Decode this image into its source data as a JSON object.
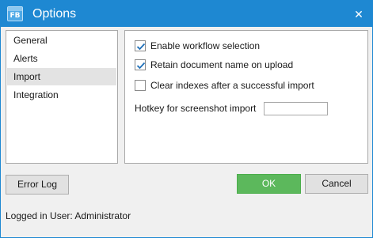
{
  "window": {
    "title": "Options",
    "app_icon_text": "FB",
    "close_glyph": "✕",
    "accent_color": "#1e88d2"
  },
  "sidebar": {
    "items": [
      {
        "label": "General",
        "selected": false
      },
      {
        "label": "Alerts",
        "selected": false
      },
      {
        "label": "Import",
        "selected": true
      },
      {
        "label": "Integration",
        "selected": false
      }
    ]
  },
  "import_settings": {
    "options": [
      {
        "label": "Enable workflow selection",
        "checked": true
      },
      {
        "label": "Retain document name on upload",
        "checked": true
      },
      {
        "label": "Clear indexes after a successful import",
        "checked": false
      }
    ],
    "hotkey_label": "Hotkey for screenshot import",
    "hotkey_value": ""
  },
  "buttons": {
    "error_log": "Error Log",
    "ok": "OK",
    "cancel": "Cancel",
    "ok_color": "#5cb85c"
  },
  "status": {
    "logged_in": "Logged in User: Administrator"
  },
  "icons": {
    "check": "check-icon",
    "close": "close-icon",
    "app": "app-logo-icon"
  }
}
